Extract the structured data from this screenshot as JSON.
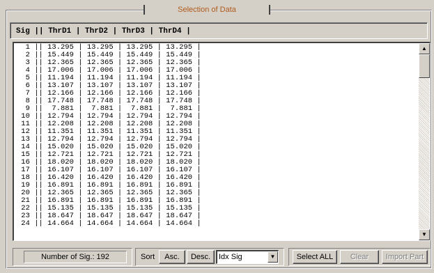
{
  "group": {
    "title": "Selection of Data"
  },
  "header": {
    "columns_text": "Sig || ThrD1 | ThrD2 | ThrD3 | ThrD4 |"
  },
  "rows": [
    "  1 || 13.295 | 13.295 | 13.295 | 13.295 |",
    "  2 || 15.449 | 15.449 | 15.449 | 15.449 |",
    "  3 || 12.365 | 12.365 | 12.365 | 12.365 |",
    "  4 || 17.006 | 17.006 | 17.006 | 17.006 |",
    "  5 || 11.194 | 11.194 | 11.194 | 11.194 |",
    "  6 || 13.107 | 13.107 | 13.107 | 13.107 |",
    "  7 || 12.166 | 12.166 | 12.166 | 12.166 |",
    "  8 || 17.748 | 17.748 | 17.748 | 17.748 |",
    "  9 ||  7.881 |  7.881 |  7.881 |  7.881 |",
    " 10 || 12.794 | 12.794 | 12.794 | 12.794 |",
    " 11 || 12.208 | 12.208 | 12.208 | 12.208 |",
    " 12 || 11.351 | 11.351 | 11.351 | 11.351 |",
    " 13 || 12.794 | 12.794 | 12.794 | 12.794 |",
    " 14 || 15.020 | 15.020 | 15.020 | 15.020 |",
    " 15 || 12.721 | 12.721 | 12.721 | 12.721 |",
    " 16 || 18.020 | 18.020 | 18.020 | 18.020 |",
    " 17 || 16.107 | 16.107 | 16.107 | 16.107 |",
    " 18 || 16.420 | 16.420 | 16.420 | 16.420 |",
    " 19 || 16.891 | 16.891 | 16.891 | 16.891 |",
    " 20 || 12.365 | 12.365 | 12.365 | 12.365 |",
    " 21 || 16.891 | 16.891 | 16.891 | 16.891 |",
    " 22 || 15.135 | 15.135 | 15.135 | 15.135 |",
    " 23 || 18.647 | 18.647 | 18.647 | 18.647 |",
    " 24 || 14.664 | 14.664 | 14.664 | 14.664 |"
  ],
  "footer": {
    "number_of_sig": "Number of Sig.: 192",
    "sort_label": "Sort",
    "asc_label": "Asc.",
    "desc_label": "Desc.",
    "sort_field": "Idx Sig",
    "select_all_label": "Select ALL",
    "clear_label": "Clear",
    "import_part_label": "Import Part"
  },
  "icons": {
    "scroll_up": "scroll-up-arrow-icon",
    "scroll_down": "scroll-down-arrow-icon",
    "dropdown": "chevron-down-icon"
  }
}
